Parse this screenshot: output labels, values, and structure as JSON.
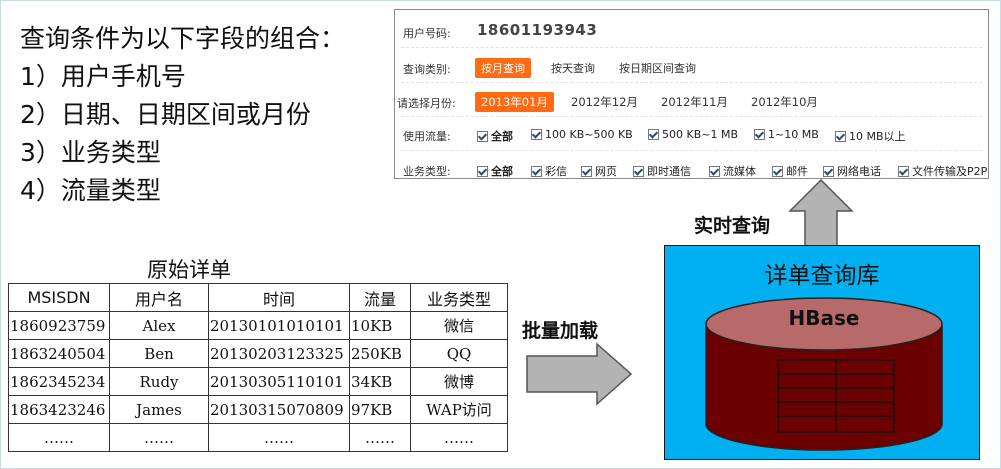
{
  "conditions": {
    "title": "查询条件为以下字段的组合：",
    "items": [
      "1）用户手机号",
      "2）日期、日期区间或月份",
      "3）业务类型",
      "4）流量类型"
    ]
  },
  "query_form": {
    "phone_label": "用户号码:",
    "phone_value": "18601193943",
    "type_label": "查询类别:",
    "type_options": [
      "按月查询",
      "按天查询",
      "按日期区间查询"
    ],
    "type_selected": 0,
    "month_label": "请选择月份:",
    "month_options": [
      "2013年01月",
      "2012年12月",
      "2012年11月",
      "2012年10月"
    ],
    "month_selected": 0,
    "traffic_label": "使用流量:",
    "traffic_options": [
      "全部",
      "100 KB~500 KB",
      "500 KB~1 MB",
      "1~10 MB",
      "10 MB以上"
    ],
    "service_label": "业务类型:",
    "service_options": [
      "全部",
      "彩信",
      "网页",
      "即时通信",
      "流媒体",
      "邮件",
      "网络电话",
      "文件传输及P2P"
    ]
  },
  "raw_table": {
    "title": "原始详单",
    "headers": [
      "MSISDN",
      "用户名",
      "时间",
      "流量",
      "业务类型"
    ],
    "rows": [
      [
        "1860923759",
        "Alex",
        "20130101010101",
        "10KB",
        "微信"
      ],
      [
        "1863240504",
        "Ben",
        "20130203123325",
        "250KB",
        "QQ"
      ],
      [
        "1862345234",
        "Rudy",
        "20130305110101",
        "34KB",
        "微博"
      ],
      [
        "1863423246",
        "James",
        "20130315070809",
        "97KB",
        "WAP访问"
      ],
      [
        "……",
        "……",
        "……",
        "……",
        "……"
      ]
    ]
  },
  "batch_load_label": "批量加载",
  "realtime_label": "实时查询",
  "detail_db": {
    "title": "详单查询库",
    "store_label": "HBase"
  },
  "colors": {
    "accent_orange": "#ff6a13",
    "db_background": "#00b0f0",
    "cylinder_body": "#6b0000",
    "cylinder_top": "#b86a6a",
    "arrow_fill": "#b3b3b3"
  }
}
